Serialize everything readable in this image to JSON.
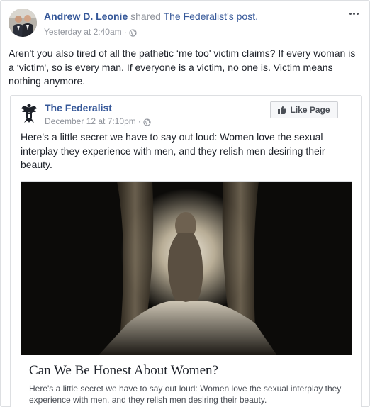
{
  "post": {
    "author": "Andrew D. Leonie",
    "shared_verb": "shared",
    "shared_source": "The Federalist",
    "shared_suffix": "'s post.",
    "timestamp": "Yesterday at 2:40am",
    "separator": "·",
    "privacy_icon": "globe-icon",
    "text": "Aren't you also tired of all the pathetic ‘me too' victim claims? If every woman is a ‘victim', so is every man. If everyone is a victim, no one is. Victim means nothing anymore."
  },
  "shared": {
    "page_name": "The Federalist",
    "timestamp": "December 12 at 7:10pm",
    "separator": "·",
    "like_button": "Like Page",
    "text": "Here's a little secret we have to say out loud: Women love the sexual interplay they experience with men, and they relish men desiring their beauty.",
    "card": {
      "title": "Can We Be Honest About Women?",
      "description": "Here's a little secret we have to say out loud: Women love the sexual interplay they experience with men, and they relish men desiring their beauty."
    }
  },
  "colors": {
    "link": "#365899",
    "muted": "#90949c",
    "text": "#1d2129",
    "border": "#dddfe2"
  }
}
